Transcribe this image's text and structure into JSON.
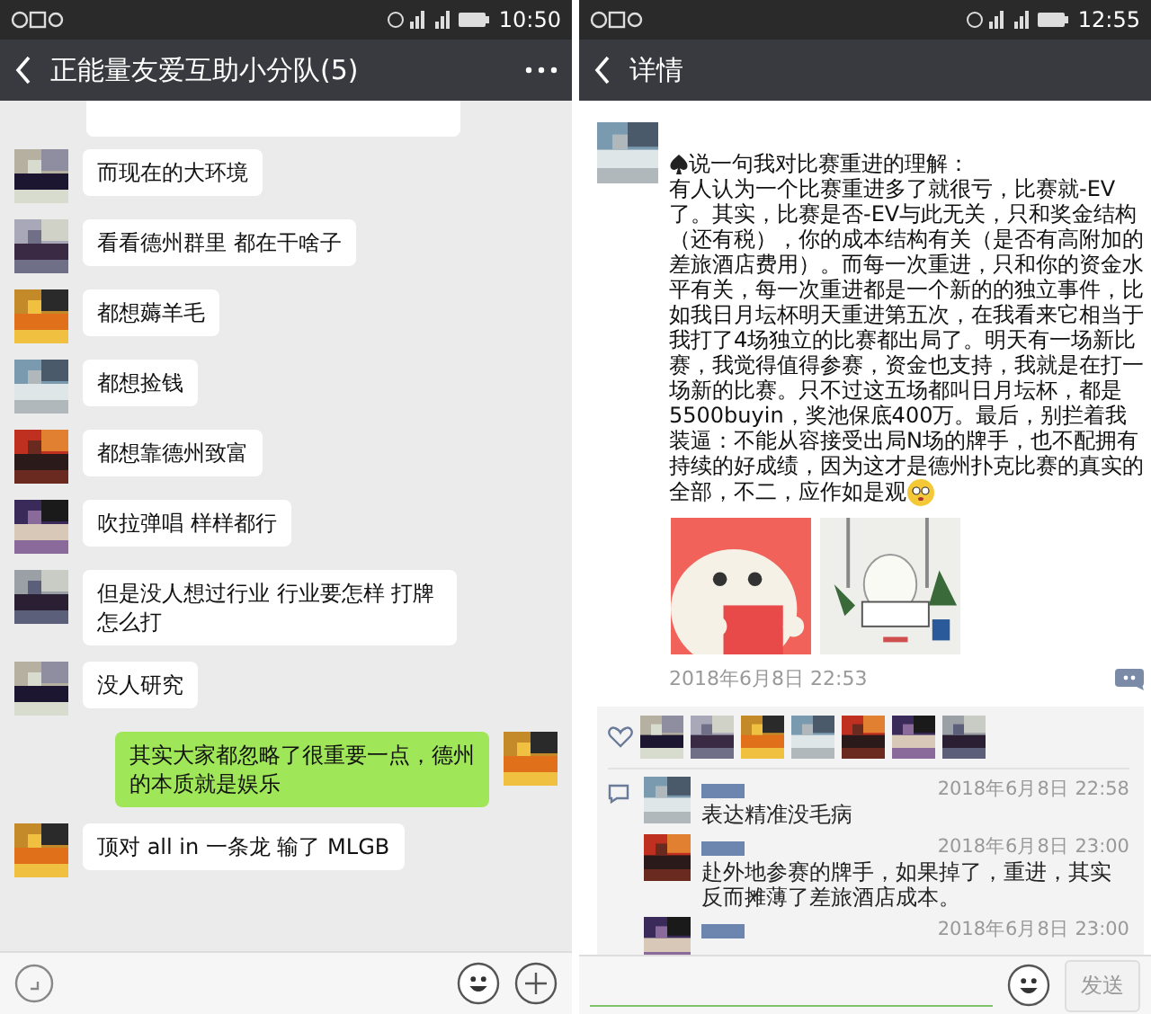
{
  "left": {
    "status_bar": {
      "time": "10:50"
    },
    "header": {
      "title": "正能量友爱互助小分队(5)"
    },
    "messages": [
      {
        "kind": "cut"
      },
      {
        "kind": "incoming",
        "text": "而现在的大环境"
      },
      {
        "kind": "incoming",
        "text": "看看德州群里 都在干啥子"
      },
      {
        "kind": "incoming",
        "text": "都想薅羊毛"
      },
      {
        "kind": "incoming",
        "text": "都想捡钱"
      },
      {
        "kind": "incoming",
        "text": "都想靠德州致富"
      },
      {
        "kind": "incoming",
        "text": "吹拉弹唱 样样都行"
      },
      {
        "kind": "incoming",
        "text": "但是没人想过行业 行业要怎样 打牌怎么打"
      },
      {
        "kind": "incoming",
        "text": "没人研究"
      },
      {
        "kind": "outgoing",
        "text": "其实大家都忽略了很重要一点，德州的本质就是娱乐"
      },
      {
        "kind": "incoming",
        "text": "顶对 all in 一条龙 输了 MLGB"
      }
    ]
  },
  "right": {
    "status_bar": {
      "time": "12:55"
    },
    "header": {
      "title": "详情"
    },
    "post": {
      "title": "说一句我对比赛重进的理解：",
      "text": "有人认为一个比赛重进多了就很亏，比赛就-EV了。其实，比赛是否-EV与此无关，只和奖金结构（还有税），你的成本结构有关（是否有高附加的差旅酒店费用）。而每一次重进，只和你的资金水平有关，每一次重进都是一个新的的独立事件，比如我日月坛杯明天重进第五次，在我看来它相当于我打了4场独立的比赛都出局了。明天有一场新比赛，我觉得值得参赛，资金也支持，我就是在打一场新的比赛。只不过这五场都叫日月坛杯，都是5500buyin，奖池保底400万。最后，别拦着我装逼：不能从容接受出局N场的牌手，也不配拥有持续的好成绩，因为这才是德州扑克比赛的真实的全部，不二，应作如是观",
      "time": "2018年6月8日 22:53"
    },
    "comments": [
      {
        "time": "2018年6月8日 22:58",
        "text": "表达精准没毛病"
      },
      {
        "time": "2018年6月8日 23:00",
        "text": "赴外地参赛的牌手，如果掉了，重进，其实反而摊薄了差旅酒店成本。"
      },
      {
        "time": "2018年6月8日 23:00"
      }
    ],
    "send_button": {
      "label": "发送",
      "disabled": true
    }
  }
}
